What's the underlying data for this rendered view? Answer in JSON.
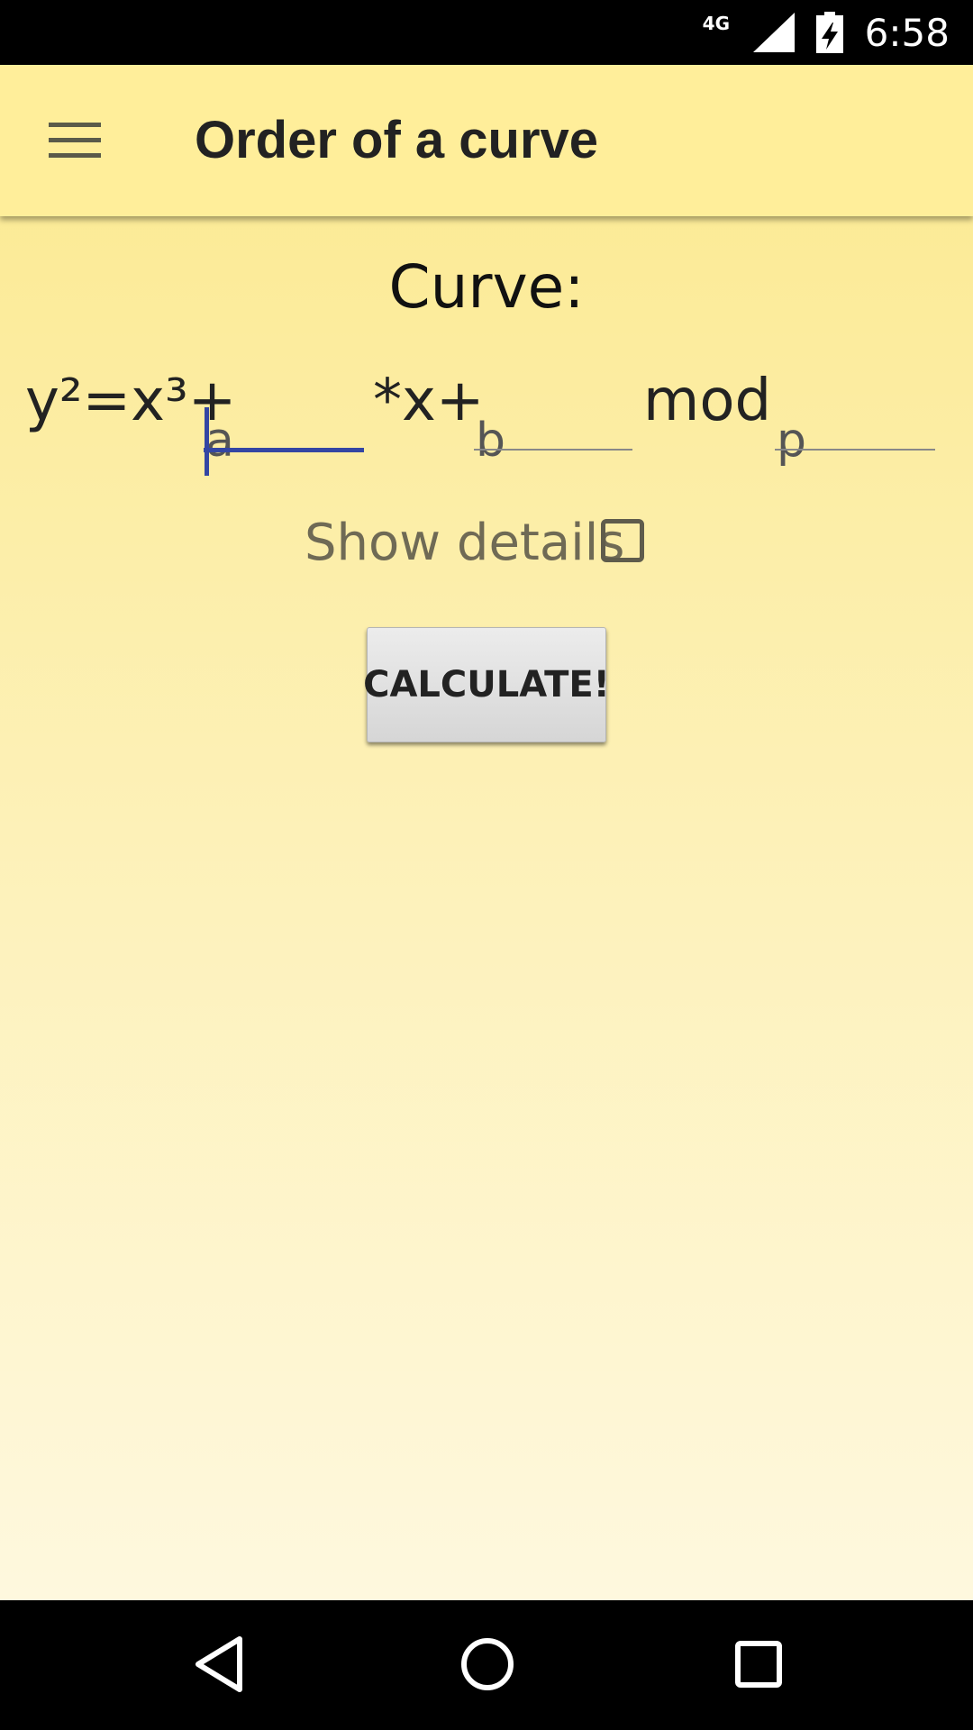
{
  "status_bar": {
    "network": "4G",
    "time": "6:58",
    "icons": [
      "signal-icon",
      "battery-charging-icon"
    ]
  },
  "toolbar": {
    "menu_icon": "menu-icon",
    "title": "Order of a curve"
  },
  "main": {
    "heading": "Curve:",
    "equation": {
      "prefix": "y²=x³+",
      "a_placeholder": "a",
      "middle": "*x+",
      "b_placeholder": "b",
      "mod_label": "mod",
      "p_placeholder": "p"
    },
    "show_details_label": "Show details",
    "show_details_checked": false,
    "calculate_label": "CALCULATE!"
  },
  "nav_bar": {
    "icons": [
      "back-icon",
      "home-icon",
      "recents-icon"
    ]
  }
}
